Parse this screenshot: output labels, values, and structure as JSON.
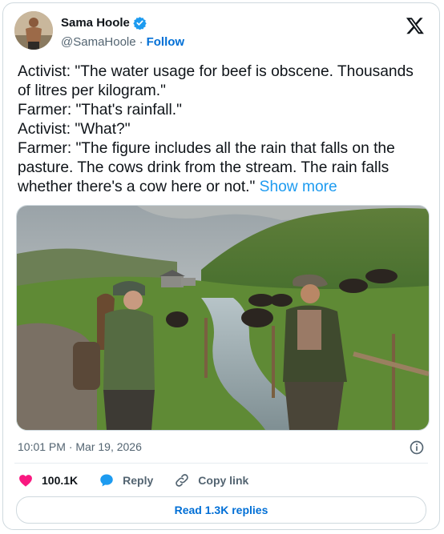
{
  "author": {
    "name": "Sama Hoole",
    "handle": "@SamaHoole",
    "separator": "·",
    "follow_label": "Follow"
  },
  "tweet": {
    "lines": [
      "Activist: \"The water usage for beef is obscene. Thousands",
      "of litres per kilogram.\"",
      "Farmer: \"That's rainfall.\"",
      "Activist: \"What?\"",
      "Farmer: \"The figure includes all the rain that falls on the",
      "pasture. The cows drink from the stream. The rain falls",
      "whether there's a cow here or not.\""
    ],
    "show_more_label": "Show more"
  },
  "meta": {
    "timestamp": "10:01 PM · Mar 19, 2026"
  },
  "actions": {
    "likes": "100.1K",
    "reply_label": "Reply",
    "copy_link_label": "Copy link"
  },
  "read_replies_label": "Read 1.3K replies",
  "colors": {
    "accent": "#1d9bf0",
    "link": "#006fd6",
    "heart": "#f91880",
    "muted": "#536471"
  },
  "icons": [
    "verified-badge-icon",
    "x-logo-icon",
    "info-icon",
    "heart-icon",
    "reply-bubble-icon",
    "link-icon"
  ]
}
